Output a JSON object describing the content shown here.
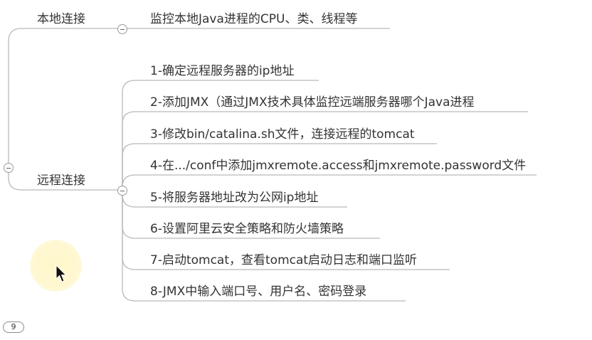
{
  "colors": {
    "line": "#b9b9b9",
    "text": "#333333",
    "cursor_highlight": "#fff6c8"
  },
  "branches": {
    "local": {
      "label": "本地连接",
      "children": [
        "监控本地Java进程的CPU、类、线程等"
      ]
    },
    "remote": {
      "label": "远程连接",
      "children": [
        "1-确定远程服务器的ip地址",
        "2-添加JMX（通过JMX技术具体监控远端服务器哪个Java进程",
        "3-修改bin/catalina.sh文件，连接远程的tomcat",
        "4-在.../conf中添加jmxremote.access和jmxremote.password文件",
        "5-将服务器地址改为公网ip地址",
        "6-设置阿里云安全策略和防火墙策略",
        "7-启动tomcat，查看tomcat启动日志和端口监听",
        "8-JMX中输入端口号、用户名、密码登录"
      ]
    }
  },
  "badge": {
    "value": "9"
  },
  "icons": {
    "collapse": "minus-circle-icon",
    "pointer": "mouse-pointer-icon"
  }
}
